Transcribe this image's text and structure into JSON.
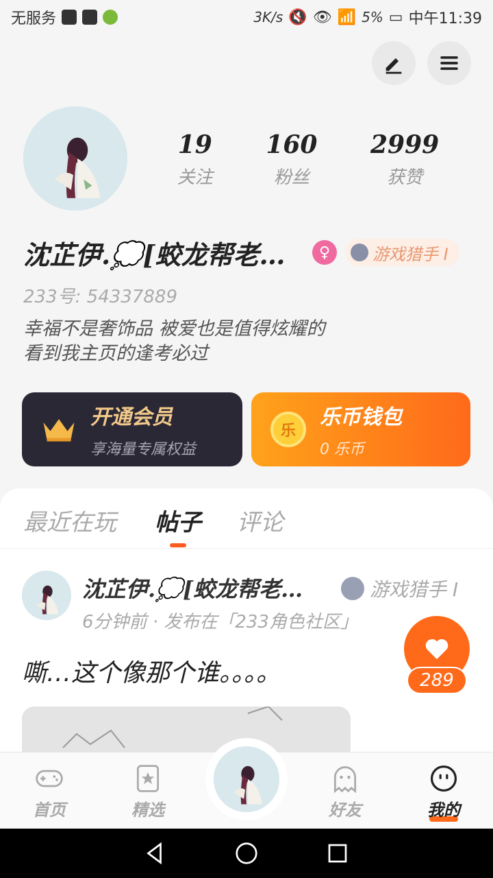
{
  "status_bar": {
    "carrier": "无服务",
    "speed": "3K/s",
    "battery": "5%",
    "time": "中午11:39"
  },
  "profile": {
    "following_count": "19",
    "following_label": "关注",
    "followers_count": "160",
    "followers_label": "粉丝",
    "likes_count": "2999",
    "likes_label": "获赞",
    "username": "沈芷伊.💭[蛟龙帮老…",
    "gender_icon": "female-icon",
    "level_badge": "游戏猎手 I",
    "uid_text": "233号: 54337889",
    "bio_line1": "幸福不是奢饰品 被爱也是值得炫耀的",
    "bio_line2": "看到我主页的逢考必过"
  },
  "cards": {
    "vip_title": "开通会员",
    "vip_subtitle": "享海量专属权益",
    "wallet_title": "乐币钱包",
    "wallet_subtitle": "0 乐币",
    "coin_glyph": "乐"
  },
  "tabs": {
    "recent": "最近在玩",
    "posts": "帖子",
    "comments": "评论",
    "active": "posts"
  },
  "post": {
    "author": "沈芷伊.💭[蛟龙帮老…",
    "level": "游戏猎手 I",
    "meta": "6分钟前 · 发布在「233角色社区」",
    "text": "嘶…这个像那个谁。。。。",
    "like_count": "289"
  },
  "bottom_nav": {
    "home": "首页",
    "featured": "精选",
    "friends": "好友",
    "me": "我的",
    "active": "me"
  },
  "colors": {
    "accent": "#ff6a1a",
    "vip_card": "#2b2836",
    "vip_gold": "#f2c98a",
    "female_badge": "#f06aa0"
  }
}
